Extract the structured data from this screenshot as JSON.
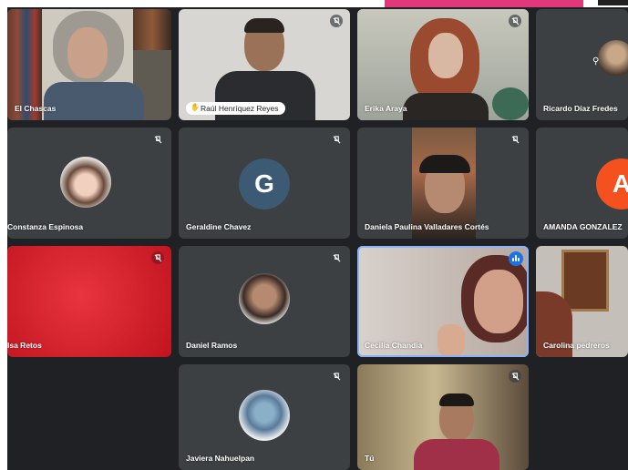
{
  "participants": [
    {
      "name": "El Chascas"
    },
    {
      "name": "Raúl Henríquez Reyes"
    },
    {
      "name": "Erika Araya"
    },
    {
      "name": "Ricardo Díaz Fredes"
    },
    {
      "name": "Constanza Espinosa"
    },
    {
      "name": "Geraldine Chavez",
      "initial": "G",
      "avatar_color": "#3c5a73"
    },
    {
      "name": "Daniela Paulina Valladares Cortés"
    },
    {
      "name": "AMANDA GONZALEZ",
      "initial": "A",
      "avatar_color": "#f4511e"
    },
    {
      "name": "Isa Retos"
    },
    {
      "name": "Daniel Ramos"
    },
    {
      "name": "Cecilia Chandia"
    },
    {
      "name": "Carolina pedreros"
    },
    {
      "name": "Javiera Nahuelpan"
    },
    {
      "name": "Tú"
    }
  ],
  "colors": {
    "background": "#202124",
    "tile": "#3c4043",
    "active_speaker": "#1a73e8",
    "accent_strip": "#e0387a"
  }
}
